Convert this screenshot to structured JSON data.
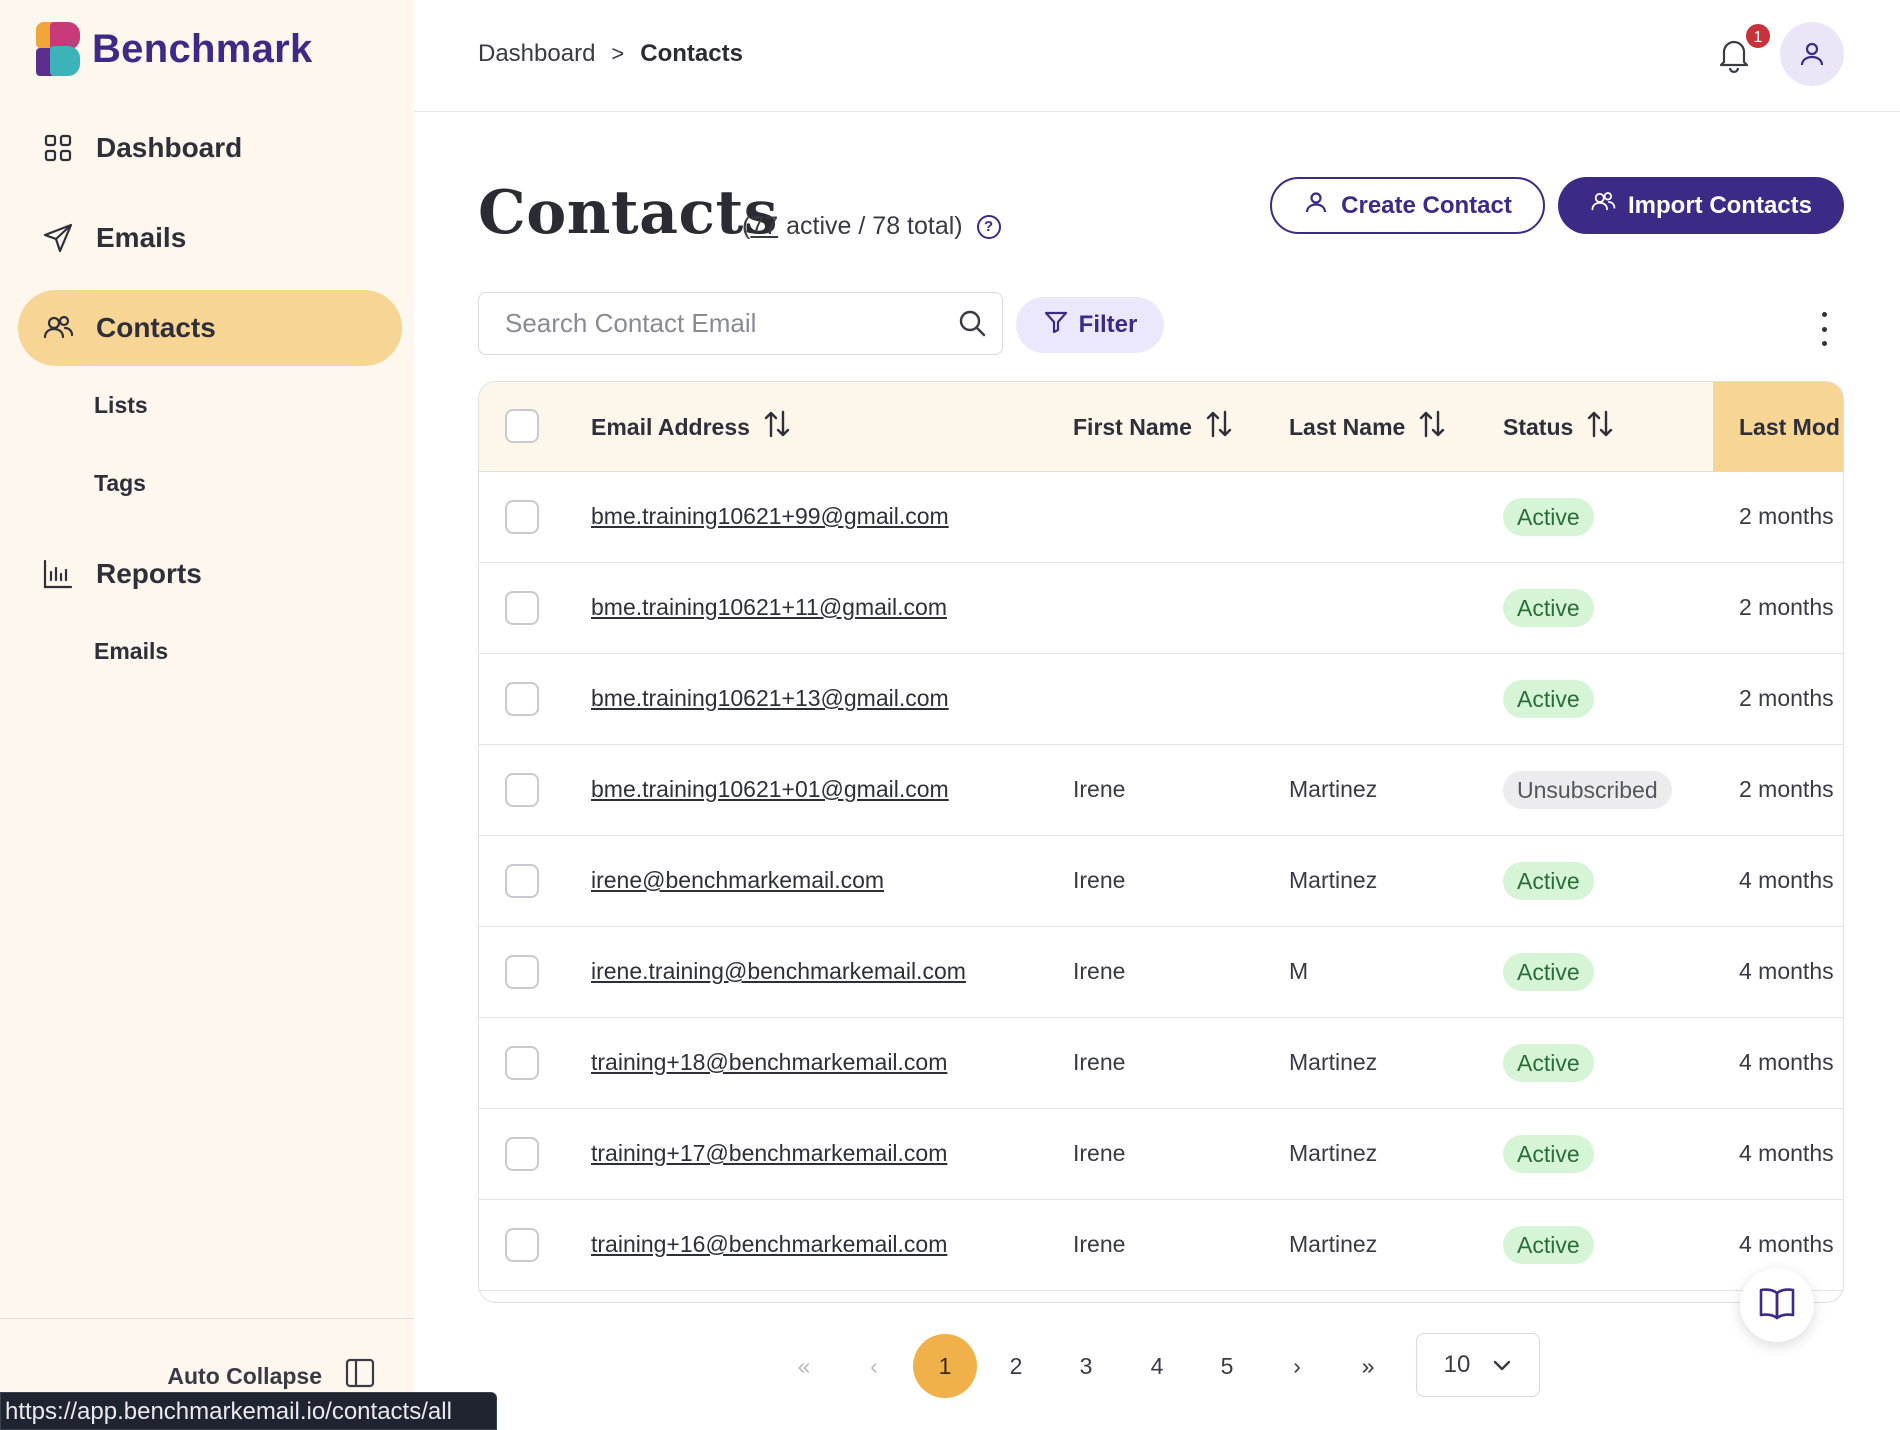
{
  "brand": {
    "name": "Benchmark",
    "colors": {
      "primary": "#3d2a86",
      "accent": "#f6d595",
      "pagination_current": "#f0b14a",
      "active_green": "#d6f4d6",
      "logo_pink": "#c83a7a",
      "logo_orange": "#f0a43a",
      "logo_teal": "#3bb3b8",
      "logo_purple": "#5b2d8c"
    }
  },
  "sidebar": {
    "items": [
      {
        "label": "Dashboard",
        "icon": "dashboard-grid-icon"
      },
      {
        "label": "Emails",
        "icon": "paper-plane-icon"
      },
      {
        "label": "Contacts",
        "icon": "users-icon",
        "active": true
      },
      {
        "label": "Lists"
      },
      {
        "label": "Tags"
      },
      {
        "label": "Reports",
        "icon": "bar-chart-icon"
      },
      {
        "label": "Emails"
      }
    ],
    "auto_collapse": "Auto Collapse"
  },
  "status_bar": {
    "url": "https://app.benchmarkemail.io/contacts/all"
  },
  "header": {
    "breadcrumb": [
      "Dashboard",
      "Contacts"
    ],
    "breadcrumb_sep": ">",
    "notifications_count": "1"
  },
  "page": {
    "title": "Contacts",
    "stats_open": "(",
    "active_count": "77",
    "active_label": "active / 78 total)",
    "help": "?",
    "create_label": "Create Contact",
    "import_label": "Import Contacts"
  },
  "search": {
    "placeholder": "Search Contact Email"
  },
  "filter": {
    "label": "Filter"
  },
  "table": {
    "columns": [
      "Email Address",
      "First Name",
      "Last Name",
      "Status",
      "Last Mod"
    ],
    "rows": [
      {
        "email": "bme.training10621+99@gmail.com",
        "first": "",
        "last": "",
        "status": "Active",
        "modified": "2 months"
      },
      {
        "email": "bme.training10621+11@gmail.com",
        "first": "",
        "last": "",
        "status": "Active",
        "modified": "2 months"
      },
      {
        "email": "bme.training10621+13@gmail.com",
        "first": "",
        "last": "",
        "status": "Active",
        "modified": "2 months"
      },
      {
        "email": "bme.training10621+01@gmail.com",
        "first": "Irene",
        "last": "Martinez",
        "status": "Unsubscribed",
        "modified": "2 months"
      },
      {
        "email": "irene@benchmarkemail.com",
        "first": "Irene",
        "last": "Martinez",
        "status": "Active",
        "modified": "4 months"
      },
      {
        "email": "irene.training@benchmarkemail.com",
        "first": "Irene",
        "last": "M",
        "status": "Active",
        "modified": "4 months"
      },
      {
        "email": "training+18@benchmarkemail.com",
        "first": "Irene",
        "last": "Martinez",
        "status": "Active",
        "modified": "4 months"
      },
      {
        "email": "training+17@benchmarkemail.com",
        "first": "Irene",
        "last": "Martinez",
        "status": "Active",
        "modified": "4 months"
      },
      {
        "email": "training+16@benchmarkemail.com",
        "first": "Irene",
        "last": "Martinez",
        "status": "Active",
        "modified": "4 months"
      }
    ]
  },
  "pagination": {
    "first": "«",
    "prev": "‹",
    "pages": [
      "1",
      "2",
      "3",
      "4",
      "5"
    ],
    "current": "1",
    "next": "›",
    "last": "»",
    "per_page": "10"
  }
}
